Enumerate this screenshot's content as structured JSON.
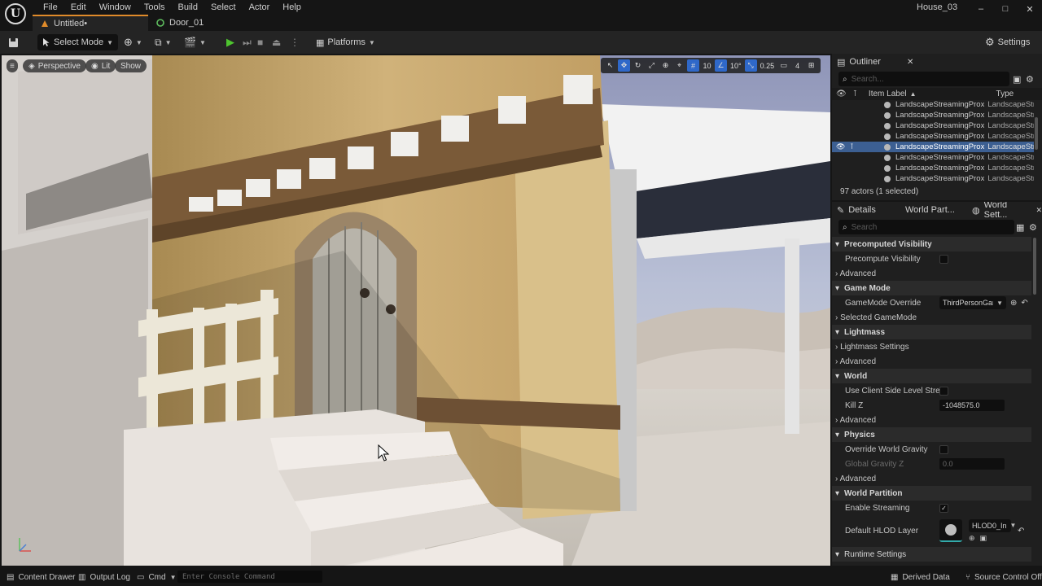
{
  "app": {
    "logo_text": "U",
    "menus": [
      "File",
      "Edit",
      "Window",
      "Tools",
      "Build",
      "Select",
      "Actor",
      "Help"
    ],
    "project_name": "House_03",
    "window_controls": [
      "–",
      "□",
      "✕"
    ]
  },
  "tabs": [
    {
      "label": "Untitled•",
      "active": true
    },
    {
      "label": "Door_01",
      "active": false
    }
  ],
  "toolbar": {
    "select_mode": "Select Mode",
    "platforms": "Platforms",
    "settings": "Settings"
  },
  "viewport": {
    "perspective": "Perspective",
    "lit": "Lit",
    "show": "Show",
    "grid_snap": "10",
    "rotation_snap": "10°",
    "scale_snap": "0.25",
    "camera_speed": "4"
  },
  "outliner": {
    "title": "Outliner",
    "search_placeholder": "Search...",
    "col_label": "Item Label",
    "col_type": "Type",
    "rows": [
      {
        "label": "LandscapeStreamingProxy_",
        "type": "LandscapeStr",
        "selected": false
      },
      {
        "label": "LandscapeStreamingProxy_",
        "type": "LandscapeStr",
        "selected": false
      },
      {
        "label": "LandscapeStreamingProxy_",
        "type": "LandscapeStr",
        "selected": false
      },
      {
        "label": "LandscapeStreamingProxy_",
        "type": "LandscapeStr",
        "selected": false
      },
      {
        "label": "LandscapeStreamingProxy_",
        "type": "LandscapeStr",
        "selected": true
      },
      {
        "label": "LandscapeStreamingProxy_",
        "type": "LandscapeStr",
        "selected": false
      },
      {
        "label": "LandscapeStreamingProxy_",
        "type": "LandscapeStr",
        "selected": false
      },
      {
        "label": "LandscapeStreamingProxy_",
        "type": "LandscapeStr",
        "selected": false
      }
    ],
    "actor_count": "97 actors (1 selected)"
  },
  "details": {
    "tabs": [
      "Details",
      "World Part...",
      "World Sett..."
    ],
    "search_placeholder": "Search",
    "sections": {
      "precomputed_visibility": "Precomputed Visibility",
      "precompute_visibility": "Precompute Visibility",
      "advanced": "Advanced",
      "game_mode": "Game Mode",
      "game_mode_override": "GameMode Override",
      "game_mode_value": "ThirdPersonGame",
      "selected_game_mode": "Selected GameMode",
      "lightmass": "Lightmass",
      "lightmass_settings": "Lightmass Settings",
      "world": "World",
      "client_side_streaming": "Use Client Side Level Streami...",
      "kill_z": "Kill Z",
      "kill_z_value": "-1048575.0",
      "physics": "Physics",
      "override_gravity": "Override World Gravity",
      "global_gravity": "Global Gravity Z",
      "global_gravity_value": "0.0",
      "world_partition": "World Partition",
      "enable_streaming": "Enable Streaming",
      "default_hlod": "Default HLOD Layer",
      "hlod_value": "HLOD0_In",
      "runtime_settings": "Runtime Settings"
    }
  },
  "statusbar": {
    "content_drawer": "Content Drawer",
    "output_log": "Output Log",
    "cmd": "Cmd",
    "console_placeholder": "Enter Console Command",
    "derived_data": "Derived Data",
    "source_control": "Source Control Off"
  },
  "colors": {
    "accent_orange": "#e08b2a",
    "play_green": "#4ec42f",
    "selection_blue": "#3c5f92",
    "active_tool_blue": "#2f68c9"
  }
}
